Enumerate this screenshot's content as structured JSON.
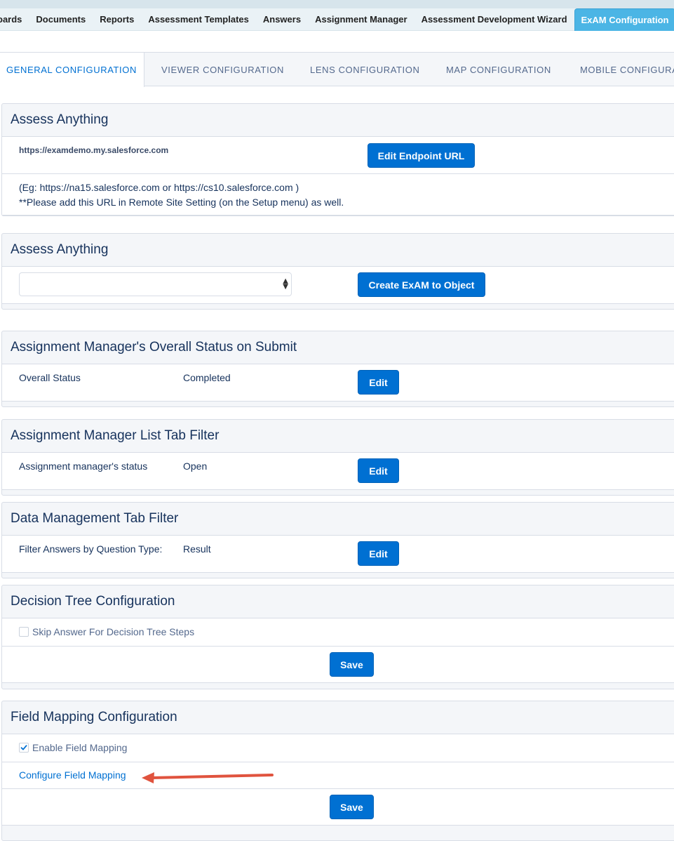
{
  "top_tabs": [
    "oards",
    "Documents",
    "Reports",
    "Assessment Templates",
    "Answers",
    "Assignment Manager",
    "Assessment Development Wizard",
    "ExAM Configuration"
  ],
  "sub_tabs": [
    "GENERAL CONFIGURATION",
    "VIEWER CONFIGURATION",
    "LENS CONFIGURATION",
    "MAP CONFIGURATION",
    "MOBILE CONFIGURATI"
  ],
  "sections": {
    "endpoint": {
      "title": "Assess Anything",
      "url": "https://examdemo.my.salesforce.com",
      "button": "Edit Endpoint URL",
      "help_line1": "(Eg: https://na15.salesforce.com or https://cs10.salesforce.com )",
      "help_line2": "**Please add this URL in Remote Site Setting (on the Setup menu) as well."
    },
    "object": {
      "title": "Assess Anything",
      "select_value": "",
      "button": "Create ExAM to Object"
    },
    "overall_status": {
      "title": "Assignment Manager's Overall Status on Submit",
      "label": "Overall Status",
      "value": "Completed",
      "button": "Edit"
    },
    "list_filter": {
      "title": "Assignment Manager List Tab Filter",
      "label": "Assignment manager's status",
      "value": "Open",
      "button": "Edit"
    },
    "data_management": {
      "title": "Data Management Tab Filter",
      "label": "Filter Answers by Question Type:",
      "value": "Result",
      "button": "Edit"
    },
    "decision_tree": {
      "title": "Decision Tree Configuration",
      "checkbox_label": "Skip Answer For Decision Tree Steps",
      "checked": false,
      "button": "Save"
    },
    "field_mapping": {
      "title": "Field Mapping Configuration",
      "checkbox_label": "Enable Field Mapping",
      "checked": true,
      "link": "Configure Field Mapping",
      "button": "Save"
    }
  },
  "colors": {
    "primary_button": "#0070d2",
    "active_top_tab": "#4bb5e5",
    "annotation_arrow": "#e0533e"
  }
}
